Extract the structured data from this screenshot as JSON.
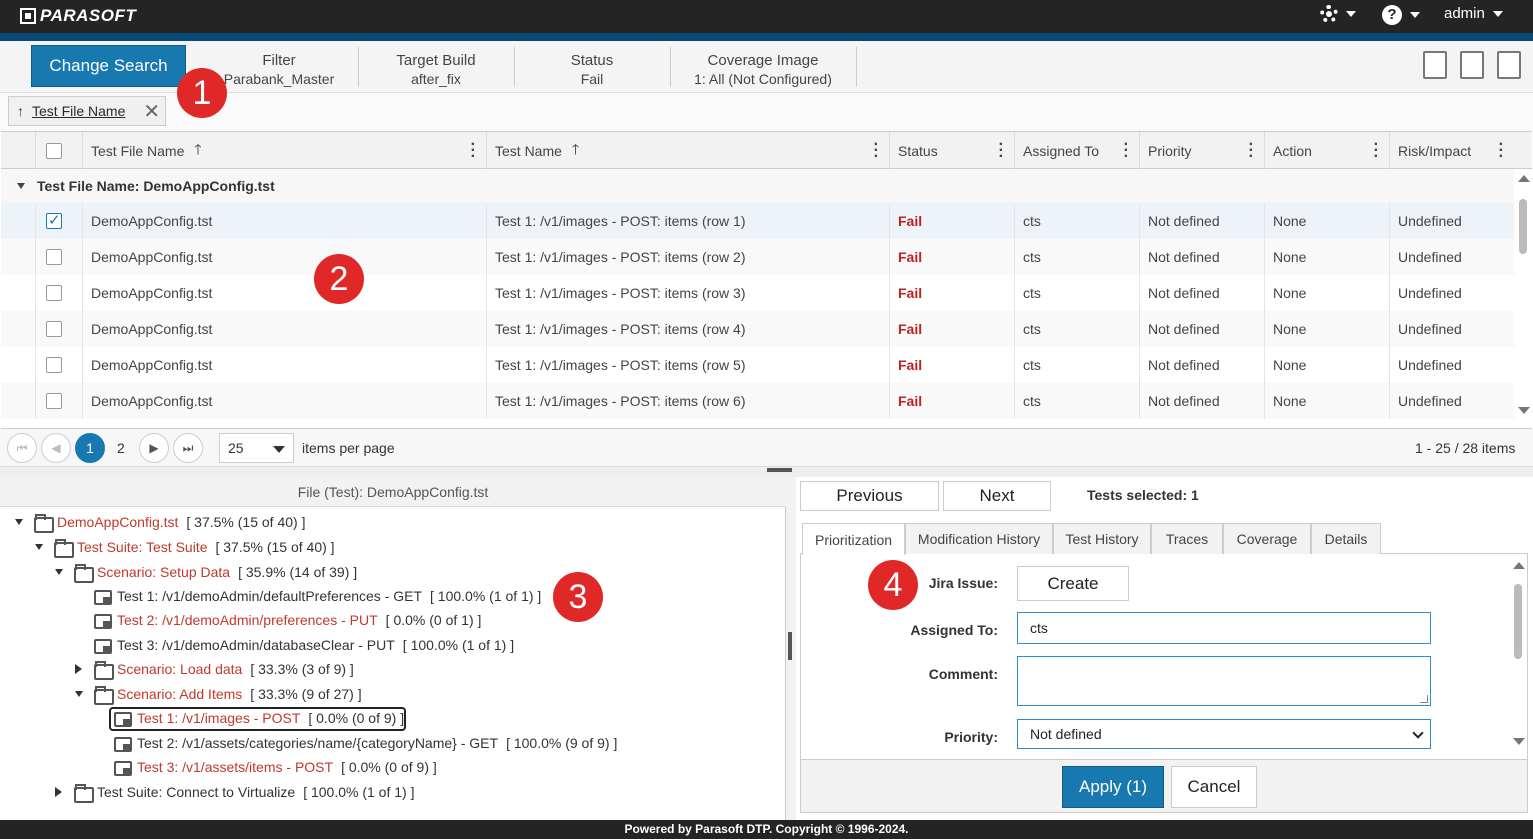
{
  "app": {
    "logo_text": "PARASOFT",
    "user": "admin",
    "footer": "Powered by Parasoft DTP. Copyright © 1996-2024."
  },
  "search": {
    "change_label": "Change Search",
    "filter_title": "Filter",
    "filter_value": "Parabank_Master",
    "target_build_title": "Target Build",
    "target_build_value": "after_fix",
    "status_title": "Status",
    "status_value": "Fail",
    "coverage_title": "Coverage Image",
    "coverage_value": "1: All (Not Configured)"
  },
  "group_chip": {
    "label": "Test File Name",
    "arrow": "↑",
    "close": "✕"
  },
  "grid": {
    "columns": [
      "Test File Name",
      "Test Name",
      "Status",
      "Assigned To",
      "Priority",
      "Action",
      "Risk/Impact"
    ],
    "group_label": "Test File Name: DemoAppConfig.tst",
    "rows": [
      {
        "file": "DemoAppConfig.tst",
        "test": "Test 1: /v1/images - POST: items (row 1)",
        "status": "Fail",
        "assigned": "cts",
        "priority": "Not defined",
        "action": "None",
        "risk": "Undefined",
        "checked": true
      },
      {
        "file": "DemoAppConfig.tst",
        "test": "Test 1: /v1/images - POST: items (row 2)",
        "status": "Fail",
        "assigned": "cts",
        "priority": "Not defined",
        "action": "None",
        "risk": "Undefined",
        "checked": false
      },
      {
        "file": "DemoAppConfig.tst",
        "test": "Test 1: /v1/images - POST: items (row 3)",
        "status": "Fail",
        "assigned": "cts",
        "priority": "Not defined",
        "action": "None",
        "risk": "Undefined",
        "checked": false
      },
      {
        "file": "DemoAppConfig.tst",
        "test": "Test 1: /v1/images - POST: items (row 4)",
        "status": "Fail",
        "assigned": "cts",
        "priority": "Not defined",
        "action": "None",
        "risk": "Undefined",
        "checked": false
      },
      {
        "file": "DemoAppConfig.tst",
        "test": "Test 1: /v1/images - POST: items (row 5)",
        "status": "Fail",
        "assigned": "cts",
        "priority": "Not defined",
        "action": "None",
        "risk": "Undefined",
        "checked": false
      },
      {
        "file": "DemoAppConfig.tst",
        "test": "Test 1: /v1/images - POST: items (row 6)",
        "status": "Fail",
        "assigned": "cts",
        "priority": "Not defined",
        "action": "None",
        "risk": "Undefined",
        "checked": false
      }
    ]
  },
  "pager": {
    "pages": [
      "1",
      "2"
    ],
    "per_page": "25",
    "per_page_label": "items per page",
    "summary": "1 - 25 / 28 items"
  },
  "tree": {
    "title": "File (Test): DemoAppConfig.tst",
    "nodes": [
      {
        "label": "DemoAppConfig.tst",
        "pct": "[ 37.5% (15 of 40) ]",
        "link": true
      },
      {
        "label": "Test Suite: Test Suite",
        "pct": "[ 37.5% (15 of 40) ]",
        "link": true
      },
      {
        "label": "Scenario: Setup Data",
        "pct": "[ 35.9% (14 of 39) ]",
        "link": true
      },
      {
        "label": "Test 1: /v1/demoAdmin/defaultPreferences - GET",
        "pct": "[ 100.0% (1 of 1) ]",
        "link": false
      },
      {
        "label": "Test 2: /v1/demoAdmin/preferences - PUT",
        "pct": "[ 0.0% (0 of 1) ]",
        "link": true
      },
      {
        "label": "Test 3: /v1/demoAdmin/databaseClear - PUT",
        "pct": "[ 100.0% (1 of 1) ]",
        "link": false
      },
      {
        "label": "Scenario: Load data",
        "pct": "[ 33.3% (3 of 9) ]",
        "link": true
      },
      {
        "label": "Scenario: Add Items",
        "pct": "[ 33.3% (9 of 27) ]",
        "link": true
      },
      {
        "label": "Test 1: /v1/images - POST",
        "pct": "[ 0.0% (0 of 9) ]",
        "link": true
      },
      {
        "label": "Test 2: /v1/assets/categories/name/{categoryName} - GET",
        "pct": "[ 100.0% (9 of 9) ]",
        "link": false
      },
      {
        "label": "Test 3: /v1/assets/items - POST",
        "pct": "[ 0.0% (0 of 9) ]",
        "link": true
      },
      {
        "label": "Test Suite: Connect to Virtualize",
        "pct": "[ 100.0% (1 of 1) ]",
        "link": false
      }
    ]
  },
  "detail": {
    "previous": "Previous",
    "next": "Next",
    "tests_selected": "Tests selected: 1",
    "tabs": [
      "Prioritization",
      "Modification History",
      "Test History",
      "Traces",
      "Coverage",
      "Details"
    ],
    "jira_label": "Jira Issue:",
    "jira_button": "Create",
    "assigned_label": "Assigned To:",
    "assigned_value": "cts",
    "comment_label": "Comment:",
    "comment_value": "",
    "priority_label": "Priority:",
    "priority_value": "Not defined",
    "apply": "Apply (1)",
    "cancel": "Cancel"
  },
  "callouts": [
    "1",
    "2",
    "3",
    "4"
  ],
  "colors": {
    "accent": "#1878b0",
    "fail": "#b22222",
    "link": "#c0392b",
    "callout": "#e02828"
  }
}
